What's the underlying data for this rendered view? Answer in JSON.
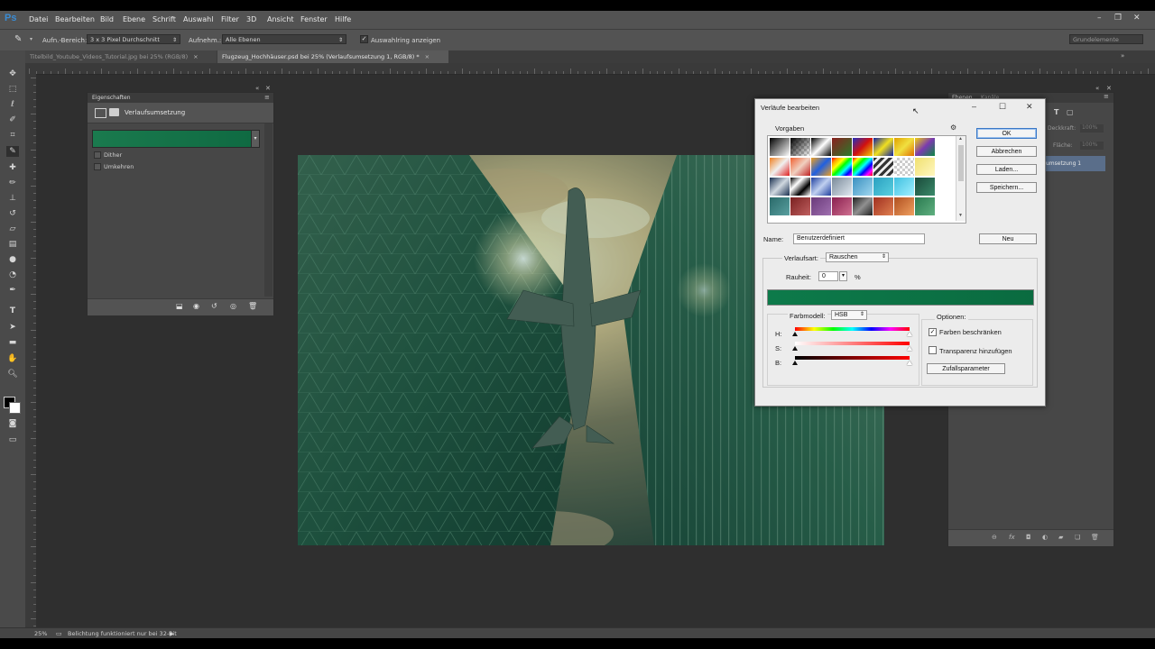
{
  "app": {
    "logo": "Ps"
  },
  "menu": [
    "Datei",
    "Bearbeiten",
    "Bild",
    "Ebene",
    "Schrift",
    "Auswahl",
    "Filter",
    "3D",
    "Ansicht",
    "Fenster",
    "Hilfe"
  ],
  "window_controls": [
    "–",
    "❐",
    "✕"
  ],
  "options_bar": {
    "sample_area_label": "Aufn.-Bereich:",
    "sample_area_value": "3 x 3 Pixel Durchschnitt",
    "sample_label": "Aufnehm.:",
    "sample_value": "Alle Ebenen",
    "show_ring_label": "Auswahlring anzeigen",
    "workspace_value": "Grundelemente"
  },
  "tabs": [
    {
      "label": "Titelbild_Youtube_Videos_Tutorial.jpg bei 25% (RGB/8)",
      "close": "×"
    },
    {
      "label": "Flugzeug_Hochhäuser.psd bei 25% (Verlaufsumsetzung 1, RGB/8) *",
      "close": "×"
    }
  ],
  "properties_panel": {
    "title": "Eigenschaften",
    "adjustment_name": "Verlaufsumsetzung",
    "dither_label": "Dither",
    "reverse_label": "Umkehren",
    "gradient_color_start": "#1a7a4e",
    "gradient_color_end": "#0f6a42"
  },
  "layers_panel": {
    "tab_layers": "Ebenen",
    "tab_channels": "Kanäle",
    "opacity_label": "Deckkraft:",
    "opacity_value": "100%",
    "fill_label": "Fläche:",
    "fill_value": "100%",
    "layer_item": "umsetzung 1"
  },
  "dialog": {
    "title": "Verläufe bearbeiten",
    "presets_label": "Vorgaben",
    "buttons": {
      "ok": "OK",
      "cancel": "Abbrechen",
      "load": "Laden...",
      "save": "Speichern...",
      "new": "Neu"
    },
    "name_label": "Name:",
    "name_value": "Benutzerdefiniert",
    "gradient_type_label": "Verlaufsart:",
    "gradient_type_value": "Rauschen",
    "roughness_label": "Rauheit:",
    "roughness_value": "0",
    "roughness_unit": "%",
    "color_model_label": "Farbmodell:",
    "color_model_value": "HSB",
    "h_label": "H:",
    "s_label": "S:",
    "b_label": "B:",
    "options_label": "Optionen:",
    "restrict_colors_label": "Farben beschränken",
    "restrict_colors_checked": true,
    "add_transparency_label": "Transparenz hinzufügen",
    "add_transparency_checked": false,
    "randomize_label": "Zufallsparameter",
    "preview_color_start": "#0d7a4a",
    "preview_color_end": "#0a6b40"
  },
  "statusbar": {
    "zoom": "25%",
    "info": "Belichtung funktioniert nur bei 32-Bit"
  }
}
